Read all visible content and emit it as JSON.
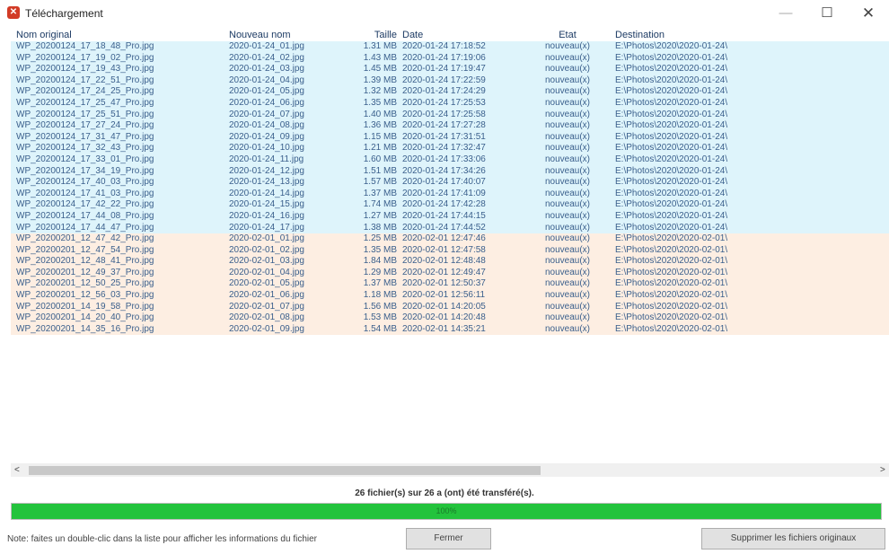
{
  "window": {
    "title": "Téléchargement",
    "icon": "app-icon"
  },
  "columns": {
    "name": "Nom original",
    "new": "Nouveau nom",
    "size": "Taille",
    "date": "Date",
    "state": "Etat",
    "dest": "Destination"
  },
  "rows": [
    {
      "name": "WP_20200124_17_18_48_Pro.jpg",
      "new": "2020-01-24_01.jpg",
      "size": "1.31 MB",
      "date": "2020-01-24 17:18:52",
      "state": "nouveau(x)",
      "dest": "E:\\Photos\\2020\\2020-01-24\\",
      "group": 1
    },
    {
      "name": "WP_20200124_17_19_02_Pro.jpg",
      "new": "2020-01-24_02.jpg",
      "size": "1.43 MB",
      "date": "2020-01-24 17:19:06",
      "state": "nouveau(x)",
      "dest": "E:\\Photos\\2020\\2020-01-24\\",
      "group": 1
    },
    {
      "name": "WP_20200124_17_19_43_Pro.jpg",
      "new": "2020-01-24_03.jpg",
      "size": "1.45 MB",
      "date": "2020-01-24 17:19:47",
      "state": "nouveau(x)",
      "dest": "E:\\Photos\\2020\\2020-01-24\\",
      "group": 1
    },
    {
      "name": "WP_20200124_17_22_51_Pro.jpg",
      "new": "2020-01-24_04.jpg",
      "size": "1.39 MB",
      "date": "2020-01-24 17:22:59",
      "state": "nouveau(x)",
      "dest": "E:\\Photos\\2020\\2020-01-24\\",
      "group": 1
    },
    {
      "name": "WP_20200124_17_24_25_Pro.jpg",
      "new": "2020-01-24_05.jpg",
      "size": "1.32 MB",
      "date": "2020-01-24 17:24:29",
      "state": "nouveau(x)",
      "dest": "E:\\Photos\\2020\\2020-01-24\\",
      "group": 1
    },
    {
      "name": "WP_20200124_17_25_47_Pro.jpg",
      "new": "2020-01-24_06.jpg",
      "size": "1.35 MB",
      "date": "2020-01-24 17:25:53",
      "state": "nouveau(x)",
      "dest": "E:\\Photos\\2020\\2020-01-24\\",
      "group": 1
    },
    {
      "name": "WP_20200124_17_25_51_Pro.jpg",
      "new": "2020-01-24_07.jpg",
      "size": "1.40 MB",
      "date": "2020-01-24 17:25:58",
      "state": "nouveau(x)",
      "dest": "E:\\Photos\\2020\\2020-01-24\\",
      "group": 1
    },
    {
      "name": "WP_20200124_17_27_24_Pro.jpg",
      "new": "2020-01-24_08.jpg",
      "size": "1.36 MB",
      "date": "2020-01-24 17:27:28",
      "state": "nouveau(x)",
      "dest": "E:\\Photos\\2020\\2020-01-24\\",
      "group": 1
    },
    {
      "name": "WP_20200124_17_31_47_Pro.jpg",
      "new": "2020-01-24_09.jpg",
      "size": "1.15 MB",
      "date": "2020-01-24 17:31:51",
      "state": "nouveau(x)",
      "dest": "E:\\Photos\\2020\\2020-01-24\\",
      "group": 1
    },
    {
      "name": "WP_20200124_17_32_43_Pro.jpg",
      "new": "2020-01-24_10.jpg",
      "size": "1.21 MB",
      "date": "2020-01-24 17:32:47",
      "state": "nouveau(x)",
      "dest": "E:\\Photos\\2020\\2020-01-24\\",
      "group": 1
    },
    {
      "name": "WP_20200124_17_33_01_Pro.jpg",
      "new": "2020-01-24_11.jpg",
      "size": "1.60 MB",
      "date": "2020-01-24 17:33:06",
      "state": "nouveau(x)",
      "dest": "E:\\Photos\\2020\\2020-01-24\\",
      "group": 1
    },
    {
      "name": "WP_20200124_17_34_19_Pro.jpg",
      "new": "2020-01-24_12.jpg",
      "size": "1.51 MB",
      "date": "2020-01-24 17:34:26",
      "state": "nouveau(x)",
      "dest": "E:\\Photos\\2020\\2020-01-24\\",
      "group": 1
    },
    {
      "name": "WP_20200124_17_40_03_Pro.jpg",
      "new": "2020-01-24_13.jpg",
      "size": "1.57 MB",
      "date": "2020-01-24 17:40:07",
      "state": "nouveau(x)",
      "dest": "E:\\Photos\\2020\\2020-01-24\\",
      "group": 1
    },
    {
      "name": "WP_20200124_17_41_03_Pro.jpg",
      "new": "2020-01-24_14.jpg",
      "size": "1.37 MB",
      "date": "2020-01-24 17:41:09",
      "state": "nouveau(x)",
      "dest": "E:\\Photos\\2020\\2020-01-24\\",
      "group": 1
    },
    {
      "name": "WP_20200124_17_42_22_Pro.jpg",
      "new": "2020-01-24_15.jpg",
      "size": "1.74 MB",
      "date": "2020-01-24 17:42:28",
      "state": "nouveau(x)",
      "dest": "E:\\Photos\\2020\\2020-01-24\\",
      "group": 1
    },
    {
      "name": "WP_20200124_17_44_08_Pro.jpg",
      "new": "2020-01-24_16.jpg",
      "size": "1.27 MB",
      "date": "2020-01-24 17:44:15",
      "state": "nouveau(x)",
      "dest": "E:\\Photos\\2020\\2020-01-24\\",
      "group": 1
    },
    {
      "name": "WP_20200124_17_44_47_Pro.jpg",
      "new": "2020-01-24_17.jpg",
      "size": "1.38 MB",
      "date": "2020-01-24 17:44:52",
      "state": "nouveau(x)",
      "dest": "E:\\Photos\\2020\\2020-01-24\\",
      "group": 1
    },
    {
      "name": "WP_20200201_12_47_42_Pro.jpg",
      "new": "2020-02-01_01.jpg",
      "size": "1.25 MB",
      "date": "2020-02-01 12:47:46",
      "state": "nouveau(x)",
      "dest": "E:\\Photos\\2020\\2020-02-01\\",
      "group": 2
    },
    {
      "name": "WP_20200201_12_47_54_Pro.jpg",
      "new": "2020-02-01_02.jpg",
      "size": "1.35 MB",
      "date": "2020-02-01 12:47:58",
      "state": "nouveau(x)",
      "dest": "E:\\Photos\\2020\\2020-02-01\\",
      "group": 2
    },
    {
      "name": "WP_20200201_12_48_41_Pro.jpg",
      "new": "2020-02-01_03.jpg",
      "size": "1.84 MB",
      "date": "2020-02-01 12:48:48",
      "state": "nouveau(x)",
      "dest": "E:\\Photos\\2020\\2020-02-01\\",
      "group": 2
    },
    {
      "name": "WP_20200201_12_49_37_Pro.jpg",
      "new": "2020-02-01_04.jpg",
      "size": "1.29 MB",
      "date": "2020-02-01 12:49:47",
      "state": "nouveau(x)",
      "dest": "E:\\Photos\\2020\\2020-02-01\\",
      "group": 2
    },
    {
      "name": "WP_20200201_12_50_25_Pro.jpg",
      "new": "2020-02-01_05.jpg",
      "size": "1.37 MB",
      "date": "2020-02-01 12:50:37",
      "state": "nouveau(x)",
      "dest": "E:\\Photos\\2020\\2020-02-01\\",
      "group": 2
    },
    {
      "name": "WP_20200201_12_56_03_Pro.jpg",
      "new": "2020-02-01_06.jpg",
      "size": "1.18 MB",
      "date": "2020-02-01 12:56:11",
      "state": "nouveau(x)",
      "dest": "E:\\Photos\\2020\\2020-02-01\\",
      "group": 2
    },
    {
      "name": "WP_20200201_14_19_58_Pro.jpg",
      "new": "2020-02-01_07.jpg",
      "size": "1.56 MB",
      "date": "2020-02-01 14:20:05",
      "state": "nouveau(x)",
      "dest": "E:\\Photos\\2020\\2020-02-01\\",
      "group": 2
    },
    {
      "name": "WP_20200201_14_20_40_Pro.jpg",
      "new": "2020-02-01_08.jpg",
      "size": "1.53 MB",
      "date": "2020-02-01 14:20:48",
      "state": "nouveau(x)",
      "dest": "E:\\Photos\\2020\\2020-02-01\\",
      "group": 2
    },
    {
      "name": "WP_20200201_14_35_16_Pro.jpg",
      "new": "2020-02-01_09.jpg",
      "size": "1.54 MB",
      "date": "2020-02-01 14:35:21",
      "state": "nouveau(x)",
      "dest": "E:\\Photos\\2020\\2020-02-01\\",
      "group": 2
    }
  ],
  "colors": {
    "group1": "#def4fb",
    "group2": "#fdeee2",
    "progress": "#23c33c"
  },
  "scroll": {
    "left": "<",
    "right": ">"
  },
  "status": "26 fichier(s) sur 26 a (ont) été transféré(s).",
  "progress": {
    "value": 1.0,
    "label": "100%"
  },
  "footer": {
    "note": "Note: faites un double-clic dans la liste pour afficher les informations du fichier",
    "close_label": "Fermer",
    "delete_label": "Supprimer les fichiers originaux"
  }
}
